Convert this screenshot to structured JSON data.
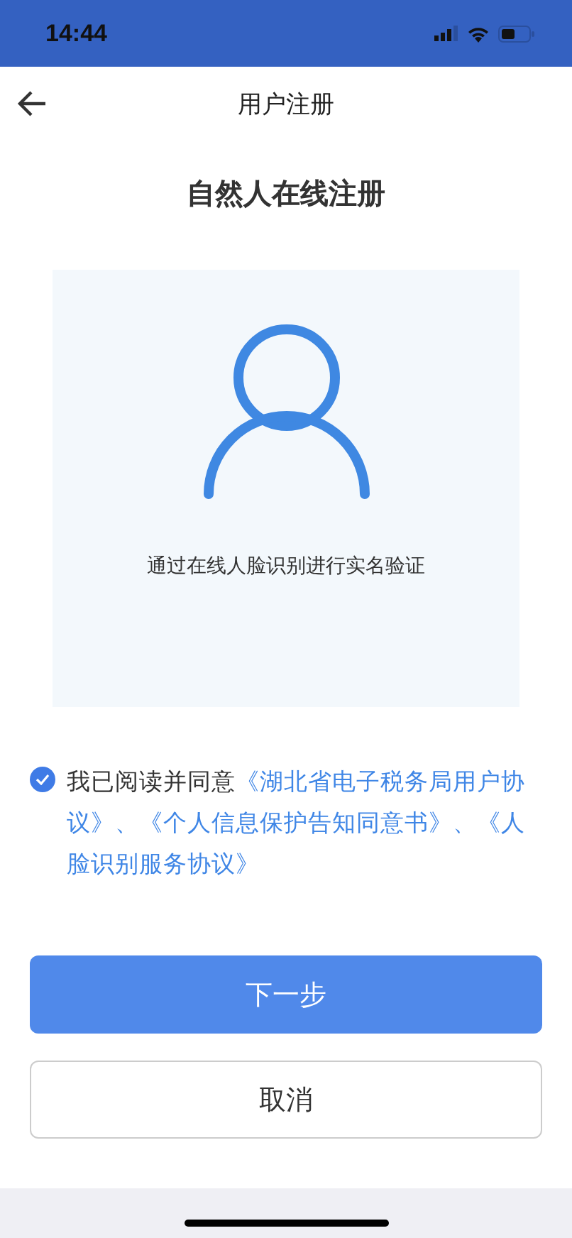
{
  "status_bar": {
    "time": "14:44"
  },
  "nav": {
    "title": "用户注册"
  },
  "heading": "自然人在线注册",
  "card": {
    "caption": "通过在线人脸识别进行实名验证"
  },
  "agreement": {
    "checked": true,
    "parts": [
      {
        "kind": "text",
        "text": "我已阅读并同意"
      },
      {
        "kind": "link",
        "text": "《湖北省电子税务局用户协议》"
      },
      {
        "kind": "link",
        "text": "、"
      },
      {
        "kind": "link",
        "text": "《个人信息保护告知同意书》"
      },
      {
        "kind": "link",
        "text": "、"
      },
      {
        "kind": "link",
        "text": "《人脸识别服务协议》"
      }
    ]
  },
  "buttons": [
    {
      "kind": "primary",
      "label": "下一步"
    },
    {
      "kind": "secondary",
      "label": "取消"
    }
  ]
}
